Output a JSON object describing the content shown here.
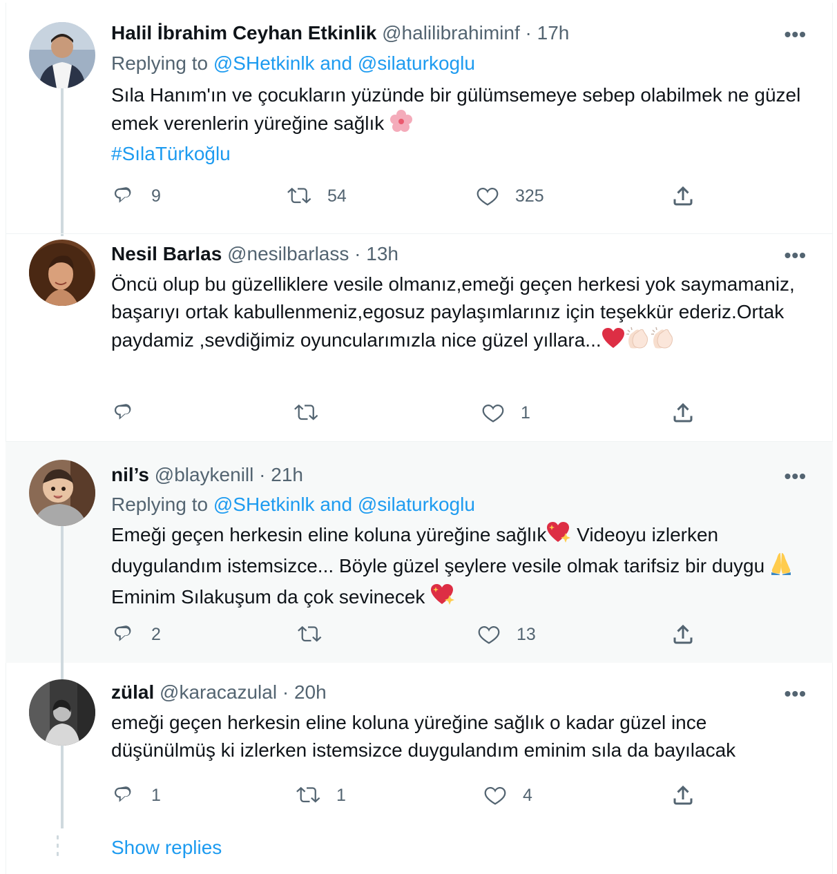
{
  "replies": [
    {
      "name": "Halil İbrahim Ceyhan Etkinlik",
      "handle": "@halilibrahiminf",
      "time": "17h",
      "replying_prefix": "Replying to",
      "replying_to": "@SHetkinlk and @silaturkoglu",
      "text": "Sıla Hanım'ın ve çocukların yüzünde bir gülümsemeye sebep olabilmek ne güzel emek verenlerin yüreğine sağlık",
      "hashtag": "#SılaTürkoğlu",
      "reply_count": "9",
      "retweet_count": "54",
      "like_count": "325"
    },
    {
      "name": "Nesil Barlas",
      "handle": "@nesilbarlass",
      "time": "13h",
      "text": "Öncü olup  bu güzelliklere vesile olmanız,emeği geçen herkesi yok saymamaniz, başarıyı ortak kabullenmeniz,egosuz paylaşımlarınız için teşekkür ederiz.Ortak paydamiz ,sevdiğimiz oyuncularımızla nice güzel yıllara...",
      "reply_count": "",
      "retweet_count": "",
      "like_count": "1"
    },
    {
      "name": "nil’s",
      "handle": "@blaykenill",
      "time": "21h",
      "replying_prefix": "Replying to",
      "replying_to": "@SHetkinlk and @silaturkoglu",
      "text_a": "Emeği geçen herkesin eline koluna yüreğine sağlık",
      "text_b": " Videoyu izlerken duygulandım istemsizce... Böyle güzel şeylere vesile olmak tarifsiz bir duygu ",
      "text_c": " Eminim Sılakuşum da çok sevinecek ",
      "reply_count": "2",
      "retweet_count": "",
      "like_count": "13"
    },
    {
      "name": "zülal",
      "handle": "@karacazulal",
      "time": "20h",
      "text": "emeği geçen herkesin eline koluna yüreğine sağlık o kadar güzel ince düşünülmüş ki izlerken istemsizce duygulandım eminim sıla da bayılacak",
      "reply_count": "1",
      "retweet_count": "1",
      "like_count": "4"
    }
  ],
  "show_replies": "Show replies",
  "colors": {
    "link": "#1d9bf0",
    "secondary": "#536471",
    "heart": "#e0245e",
    "highlight_bg": "#f7f9f9"
  },
  "icons": [
    "reply-icon",
    "retweet-icon",
    "like-icon",
    "share-icon",
    "more-icon",
    "cherry-blossom-emoji",
    "red-heart-emoji",
    "clapping-hands-emoji",
    "sparkling-heart-emoji",
    "folded-hands-emoji"
  ]
}
